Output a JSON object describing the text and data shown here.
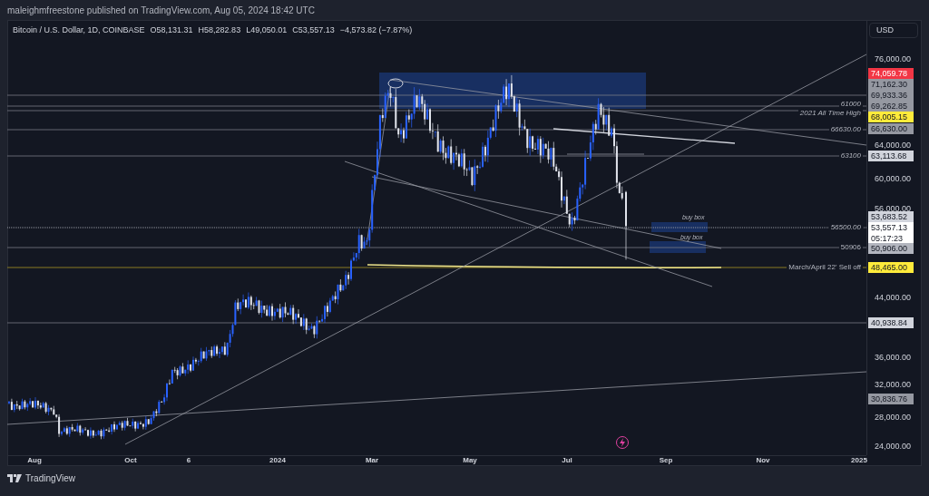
{
  "publisher_line": "maleighmfreestone published on TradingView.com, Aug 05, 2024 18:42 UTC",
  "chart": {
    "legend": [
      "Bitcoin / U.S. Dollar, 1D, COINBASE",
      "O58,131.31",
      "H58,282.83",
      "L49,050.01",
      "C53,557.13",
      "−4,573.82 (−7.87%)"
    ],
    "currency_button": "USD",
    "price_ticks": [
      "76,000.00",
      "64,000.00",
      "60,000.00",
      "56,000.00",
      "44,000.00",
      "36,000.00",
      "32,000.00",
      "28,000.00",
      "24,000.00"
    ],
    "price_labels": [
      {
        "value": "74,059.78",
        "color": "#f23645"
      },
      {
        "value": "71,162.30",
        "color": "#9598a1"
      },
      {
        "value": "69,933.36",
        "color": "#9598a1"
      },
      {
        "value": "69,262.85",
        "color": "#9598a1"
      },
      {
        "value": "68,005.15",
        "color": "#ffeb3b"
      },
      {
        "value": "66,630.00",
        "color": "#9598a1"
      },
      {
        "value": "63,113.68",
        "color": "#d1d4dc"
      },
      {
        "value": "53,683.52",
        "color": "#d1d4dc"
      },
      {
        "value": "53,557.13",
        "countdown": "05:17:23",
        "color": "#ffffff"
      },
      {
        "value": "50,906.00",
        "color": "#b2b5be"
      },
      {
        "value": "48,465.00",
        "color": "#ffeb3b"
      },
      {
        "value": "40,938.84",
        "color": "#d1d4dc"
      },
      {
        "value": "30,836.76",
        "color": "#9598a1"
      }
    ],
    "line_labels": [
      "61000",
      "2021 All Time High",
      "66630.00",
      "63100",
      "56500.00",
      "50906",
      "March/April 22' Sell off"
    ],
    "box_labels": [
      "buy box",
      "buy box"
    ],
    "time_ticks": [
      "Aug",
      "Oct",
      "6",
      "2024",
      "Mar",
      "May",
      "Jul",
      "Sep",
      "Nov",
      "2025"
    ]
  },
  "footer": {
    "logo_text": "TradingView"
  }
}
